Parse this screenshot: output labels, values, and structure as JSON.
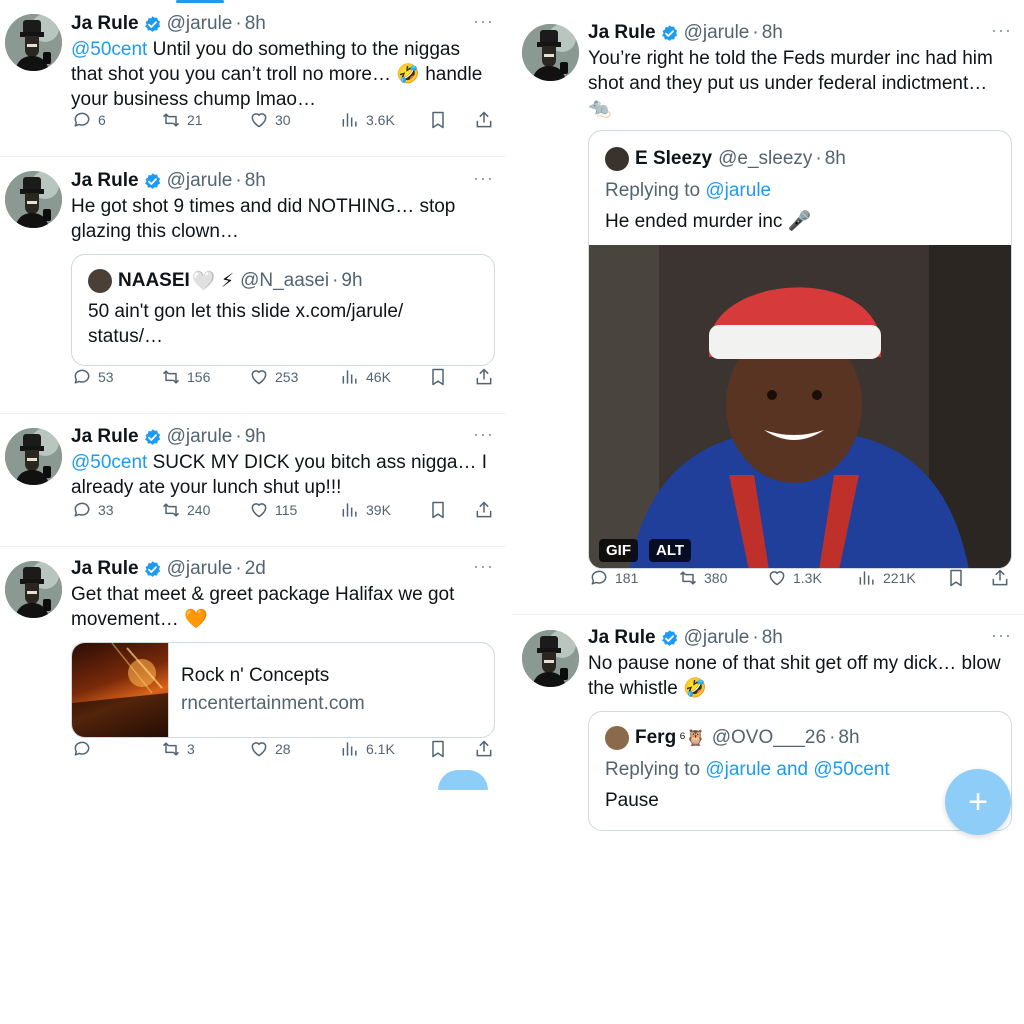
{
  "left": {
    "tweets": [
      {
        "name": "Ja Rule",
        "handle": "@jarule",
        "time": "8h",
        "mention": "@50cent",
        "text": " Until you do something to the niggas that shot you you can’t troll no more… 🤣 handle your business chump lmao…",
        "replies": "6",
        "reposts": "21",
        "likes": "30",
        "views": "3.6K"
      },
      {
        "name": "Ja Rule",
        "handle": "@jarule",
        "time": "8h",
        "text": "He got shot 9 times and did NOTHING… stop glazing this clown…",
        "quote": {
          "name": "NAASEI",
          "name_emoji": "🤍 ⚡",
          "handle": "@N_aasei",
          "time": "9h",
          "text": "50 ain't gon let this slide x.com/jarule/ status/…"
        },
        "replies": "53",
        "reposts": "156",
        "likes": "253",
        "views": "46K"
      },
      {
        "name": "Ja Rule",
        "handle": "@jarule",
        "time": "9h",
        "mention": "@50cent",
        "text": " SUCK MY DICK you bitch ass nigga… I already ate your lunch shut up!!!",
        "replies": "33",
        "reposts": "240",
        "likes": "115",
        "views": "39K"
      },
      {
        "name": "Ja Rule",
        "handle": "@jarule",
        "time": "2d",
        "text": "Get that meet & greet package Halifax we got movement… 🧡",
        "card": {
          "title": "Rock n' Concepts",
          "domain": "rncentertainment.com"
        },
        "replies": "",
        "reposts": "3",
        "likes": "28",
        "views": "6.1K"
      }
    ]
  },
  "right": {
    "tweets": [
      {
        "name": "Ja Rule",
        "handle": "@jarule",
        "time": "8h",
        "text": "You’re right he told the Feds murder inc had him shot and they put us under federal indictment… 🐀",
        "quote": {
          "name": "E Sleezy",
          "handle": "@e_sleezy",
          "time": "8h",
          "replying_prefix": "Replying to ",
          "replying_to": "@jarule",
          "text": "He ended murder inc 🎤",
          "media_badges": [
            "GIF",
            "ALT"
          ]
        },
        "replies": "181",
        "reposts": "380",
        "likes": "1.3K",
        "views": "221K"
      },
      {
        "name": "Ja Rule",
        "handle": "@jarule",
        "time": "8h",
        "text": "No pause none of that shit get off my dick… blow the whistle 🤣",
        "quote": {
          "name": "Ferg",
          "name_emoji": "⁶🦉",
          "handle": "@OVO___26",
          "time": "8h",
          "replying_prefix": "Replying to ",
          "replying_to": "@jarule and @50cent",
          "text": "Pause"
        }
      }
    ]
  },
  "ui": {
    "dot": "·",
    "more": "···",
    "fab_icon": "+"
  },
  "colors": {
    "accent": "#1d9bf0",
    "secondary_text": "#536471",
    "border": "#cfd9de",
    "fab": "#8ecdf8"
  }
}
